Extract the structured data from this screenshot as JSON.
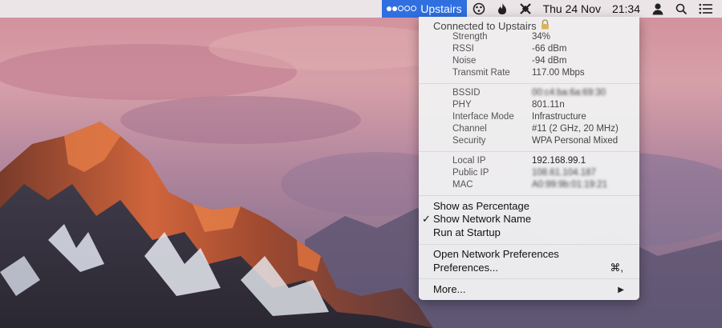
{
  "menubar": {
    "wifi_label": "Upstairs",
    "date": "Thu 24 Nov",
    "time": "21:34",
    "icons": [
      "wifi-strength-icon",
      "monitor-app-icon",
      "flame-app-icon",
      "tools-app-icon",
      "user-icon",
      "spotlight-search-icon",
      "notification-center-icon"
    ]
  },
  "menu": {
    "connected": "Connected to Upstairs",
    "signal": [
      {
        "key": "Strength",
        "value": "34%"
      },
      {
        "key": "RSSI",
        "value": "-66 dBm"
      },
      {
        "key": "Noise",
        "value": "-94 dBm"
      },
      {
        "key": "Transmit Rate",
        "value": "117.00 Mbps"
      }
    ],
    "network": [
      {
        "key": "BSSID",
        "value": "00:c4:ba:6a:69:30"
      },
      {
        "key": "PHY",
        "value": "801.11n"
      },
      {
        "key": "Interface Mode",
        "value": "Infrastructure"
      },
      {
        "key": "Channel",
        "value": "#11 (2 GHz, 20 MHz)"
      },
      {
        "key": "Security",
        "value": "WPA Personal Mixed"
      }
    ],
    "address": [
      {
        "key": "Local IP",
        "value": "192.168.99.1"
      },
      {
        "key": "Public IP",
        "value": "108.61.104.187"
      },
      {
        "key": "MAC",
        "value": "A0:99:9b:01:19:21"
      }
    ],
    "options": {
      "percentage": "Show as Percentage",
      "network_name": "Show Network Name",
      "startup": "Run at Startup",
      "check_mark": "✓"
    },
    "actions": {
      "open_prefs": "Open Network Preferences",
      "prefs": "Preferences...",
      "prefs_shortcut": "⌘,"
    },
    "more": "More...",
    "more_arrow": "▶"
  }
}
